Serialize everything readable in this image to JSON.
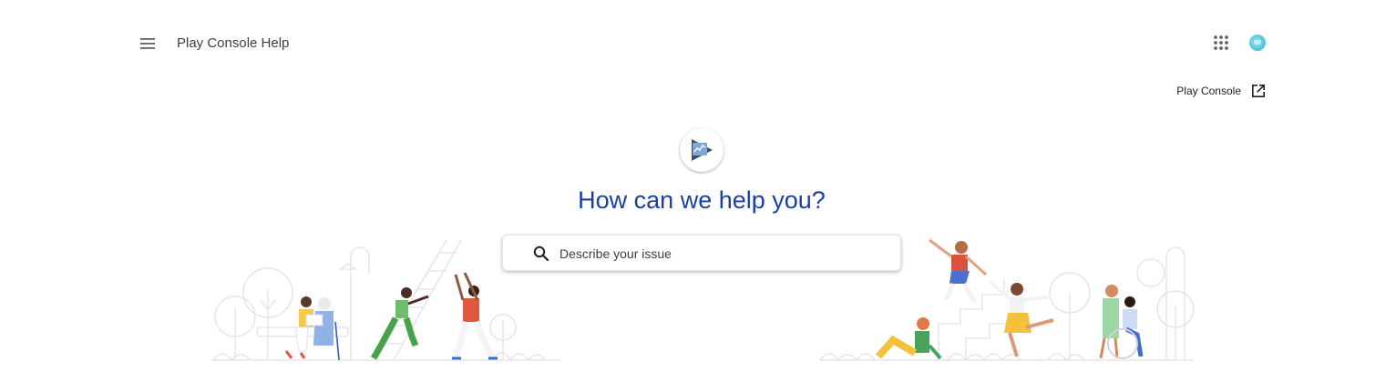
{
  "header": {
    "app_title": "Play Console Help",
    "menu_icon": "hamburger-menu-icon",
    "apps_icon": "apps-grid-icon",
    "avatar_icon": "account-avatar"
  },
  "console_link": {
    "label": "Play Console",
    "icon": "open-in-new-icon"
  },
  "hero": {
    "logo_icon": "play-console-logo",
    "title": "How can we help you?"
  },
  "search": {
    "placeholder": "Describe your issue",
    "value": "",
    "icon": "search-icon"
  },
  "colors": {
    "accent": "#1a3fa6",
    "text": "#202124",
    "muted": "#5f6368"
  }
}
